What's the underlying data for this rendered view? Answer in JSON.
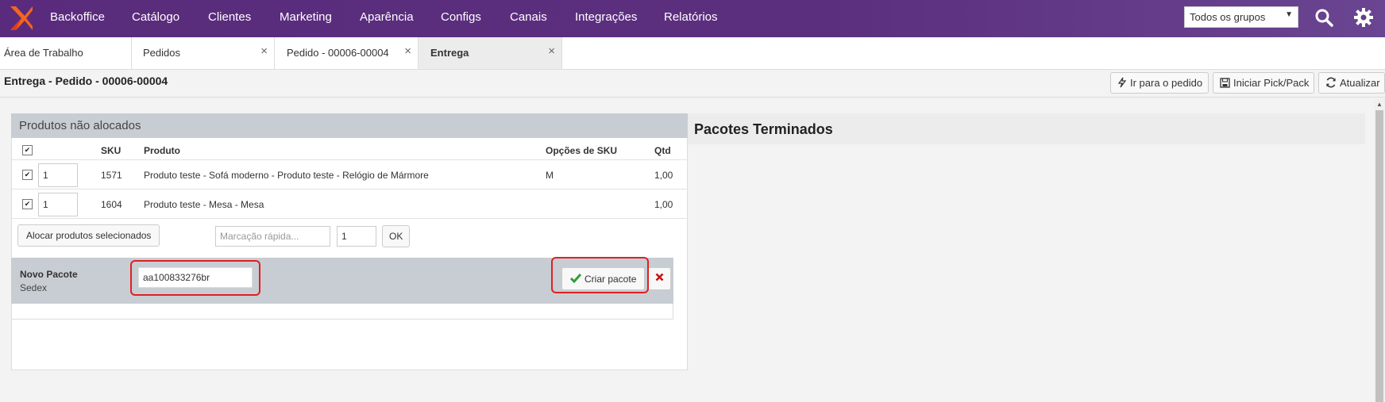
{
  "nav": {
    "items": [
      "Backoffice",
      "Catálogo",
      "Clientes",
      "Marketing",
      "Aparência",
      "Configs",
      "Canais",
      "Integrações",
      "Relatórios"
    ],
    "group_select": "Todos os grupos"
  },
  "tabs": [
    {
      "label": "Área de Trabalho"
    },
    {
      "label": "Pedidos",
      "close": "×"
    },
    {
      "label": "Pedido - 00006-00004",
      "close": "×"
    },
    {
      "label": "Entrega",
      "close": "×"
    }
  ],
  "page": {
    "title": "Entrega - Pedido - 00006-00004",
    "toolbar": {
      "go_to_order": "Ir para o pedido",
      "start_pick_pack": "Iniciar Pick/Pack",
      "refresh": "Atualizar"
    }
  },
  "unallocated": {
    "title": "Produtos não alocados",
    "columns": {
      "sku": "SKU",
      "product": "Produto",
      "sku_options": "Opções de SKU",
      "qty": "Qtd"
    },
    "rows": [
      {
        "qty_input": "1",
        "sku": "1571",
        "product": "Produto teste - Sofá moderno - Produto teste - Relógio de Mármore",
        "option": "M",
        "qty": "1,00"
      },
      {
        "qty_input": "1",
        "sku": "1604",
        "product": "Produto teste - Mesa - Mesa",
        "option": "",
        "qty": "1,00"
      }
    ],
    "allocate_button": "Alocar produtos selecionados",
    "quick_mark_placeholder": "Marcação rápida...",
    "quick_qty": "1",
    "ok_button": "OK"
  },
  "new_package": {
    "title": "Novo Pacote",
    "carrier": "Sedex",
    "tracking_value": "aa100833276br",
    "create_button": "Criar pacote"
  },
  "finished": {
    "title": "Pacotes Terminados"
  },
  "colors": {
    "nav_bg": "#5a2b7c",
    "highlight": "#e02020",
    "check_green": "#2e9e3e",
    "cancel_red": "#cc1111"
  }
}
